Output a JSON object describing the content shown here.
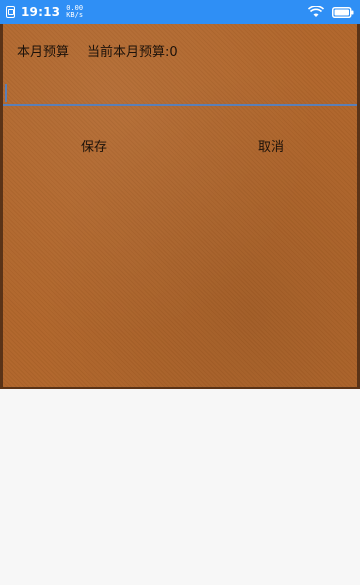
{
  "status_bar": {
    "time": "19:13",
    "speed_value": "0.00",
    "speed_unit": "KB/s",
    "background_color": "#2f8ff5",
    "icons": [
      "sim-icon",
      "wifi-icon",
      "battery-icon"
    ]
  },
  "budget": {
    "monthly_label": "本月预算",
    "current_label": "当前本月预算:0",
    "input_value": "",
    "input_placeholder": ""
  },
  "actions": {
    "save_label": "保存",
    "cancel_label": "取消"
  },
  "colors": {
    "card_background": "#b0652a",
    "input_underline": "#5b7fb6",
    "text": "#1c120a"
  }
}
